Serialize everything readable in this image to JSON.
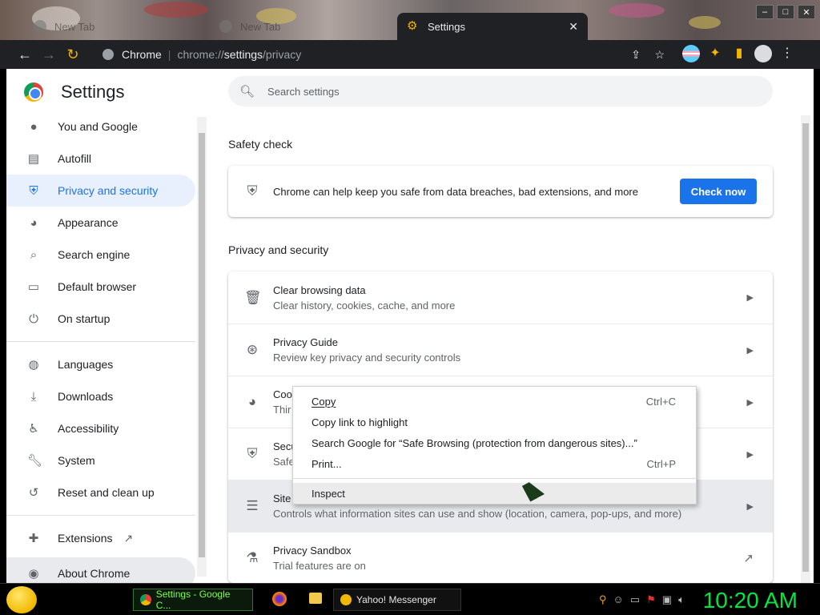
{
  "window": {
    "tabs": [
      {
        "label": "New Tab",
        "active": false
      },
      {
        "label": "New Tab",
        "active": false
      },
      {
        "label": "Settings",
        "active": true
      }
    ],
    "close_tab": "✕",
    "buttons": {
      "minimize": "–",
      "maximize": "□",
      "close": "✕"
    }
  },
  "omnibox": {
    "site_label": "Chrome",
    "url_prefix": "chrome://",
    "url_host": "settings",
    "url_path": "/privacy"
  },
  "settings": {
    "title": "Settings",
    "search_placeholder": "Search settings",
    "sidebar": [
      {
        "label": "You and Google",
        "icon": "person-icon"
      },
      {
        "label": "Autofill",
        "icon": "clipboard-icon"
      },
      {
        "label": "Privacy and security",
        "icon": "shield-icon",
        "active": true
      },
      {
        "label": "Appearance",
        "icon": "palette-icon"
      },
      {
        "label": "Search engine",
        "icon": "search-icon"
      },
      {
        "label": "Default browser",
        "icon": "browser-icon"
      },
      {
        "label": "On startup",
        "icon": "power-icon"
      },
      {
        "label": "Languages",
        "icon": "globe-icon"
      },
      {
        "label": "Downloads",
        "icon": "download-icon"
      },
      {
        "label": "Accessibility",
        "icon": "accessibility-icon"
      },
      {
        "label": "System",
        "icon": "wrench-icon"
      },
      {
        "label": "Reset and clean up",
        "icon": "history-icon"
      },
      {
        "label": "Extensions",
        "icon": "puzzle-icon"
      },
      {
        "label": "About Chrome",
        "icon": "chrome-icon"
      }
    ],
    "safety": {
      "heading": "Safety check",
      "text": "Chrome can help keep you safe from data breaches, bad extensions, and more",
      "button": "Check now"
    },
    "privacy": {
      "heading": "Privacy and security",
      "rows": [
        {
          "title": "Clear browsing data",
          "subtitle": "Clear history, cookies, cache, and more"
        },
        {
          "title": "Privacy Guide",
          "subtitle": "Review key privacy and security controls"
        },
        {
          "title": "Coo",
          "subtitle": "Thir"
        },
        {
          "title": "Secu",
          "subtitle": "Safe"
        },
        {
          "title": "Site",
          "subtitle": "Controls what information sites can use and show (location, camera, pop-ups, and more)"
        },
        {
          "title": "Privacy Sandbox",
          "subtitle": "Trial features are on"
        }
      ]
    }
  },
  "context_menu": {
    "items": [
      {
        "label": "Copy",
        "shortcut": "Ctrl+C"
      },
      {
        "label": "Copy link to highlight",
        "shortcut": ""
      },
      {
        "label": "Search Google for “Safe Browsing (protection from dangerous sites)...”",
        "shortcut": ""
      },
      {
        "label": "Print...",
        "shortcut": "Ctrl+P"
      },
      {
        "label": "Inspect",
        "shortcut": ""
      }
    ]
  },
  "taskbar": {
    "tasks": [
      "Settings - Google C...",
      "Yahoo! Messenger"
    ],
    "clock": "10:20 AM"
  }
}
